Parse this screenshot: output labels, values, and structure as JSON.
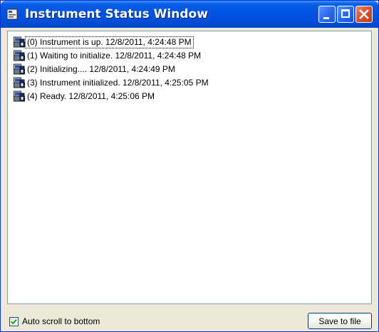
{
  "window": {
    "title": "Instrument Status Window",
    "title_color": "#ffffff",
    "titlebar_color": "#0054e3"
  },
  "log": {
    "entries": [
      {
        "text": "(0) Instrument is up. 12/8/2011, 4:24:48 PM",
        "icon": "instrument-icon",
        "focused": true
      },
      {
        "text": "(1) Waiting to initialize. 12/8/2011, 4:24:48 PM",
        "icon": "instrument-icon"
      },
      {
        "text": "(2) Initializing.... 12/8/2011, 4:24:49 PM",
        "icon": "instrument-icon"
      },
      {
        "text": "(3) Instrument initialized. 12/8/2011, 4:25:05 PM",
        "icon": "instrument-icon"
      },
      {
        "text": "(4) Ready. 12/8/2011, 4:25:06 PM",
        "icon": "instrument-icon"
      }
    ]
  },
  "footer": {
    "auto_scroll_label": "Auto scroll to bottom",
    "auto_scroll_checked": true,
    "save_label": "Save to file"
  }
}
